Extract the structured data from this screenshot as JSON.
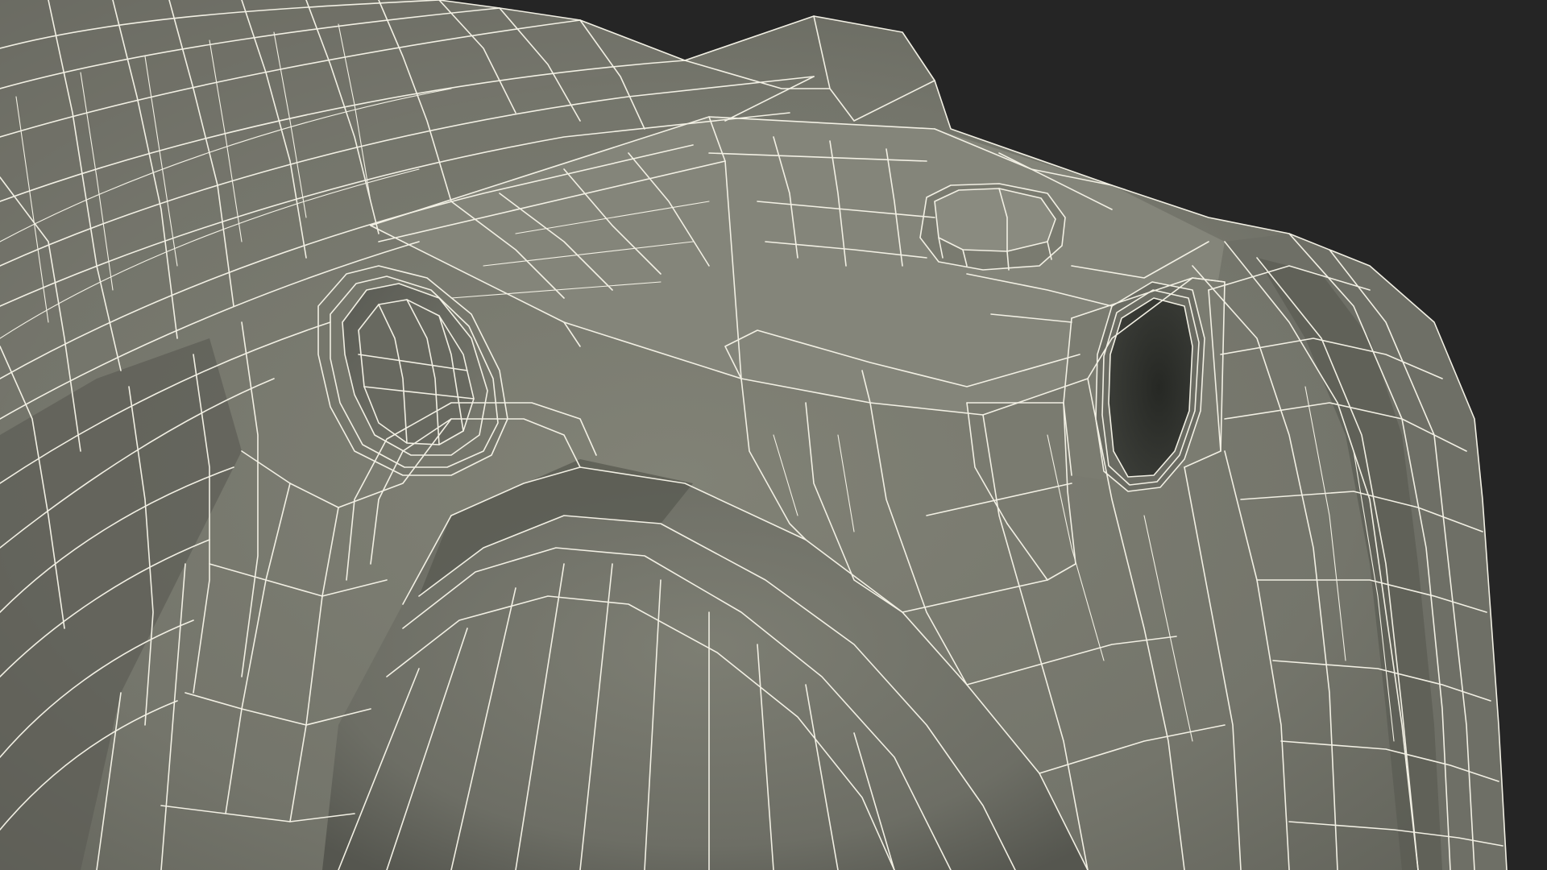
{
  "scene": {
    "colors": {
      "background": "#252525",
      "surface_light": "#7e7f74",
      "surface_mid": "#6f7066",
      "surface_dark": "#55564f",
      "hole_interior": "#2e302c",
      "wireframe": "#f2f0e4"
    }
  }
}
